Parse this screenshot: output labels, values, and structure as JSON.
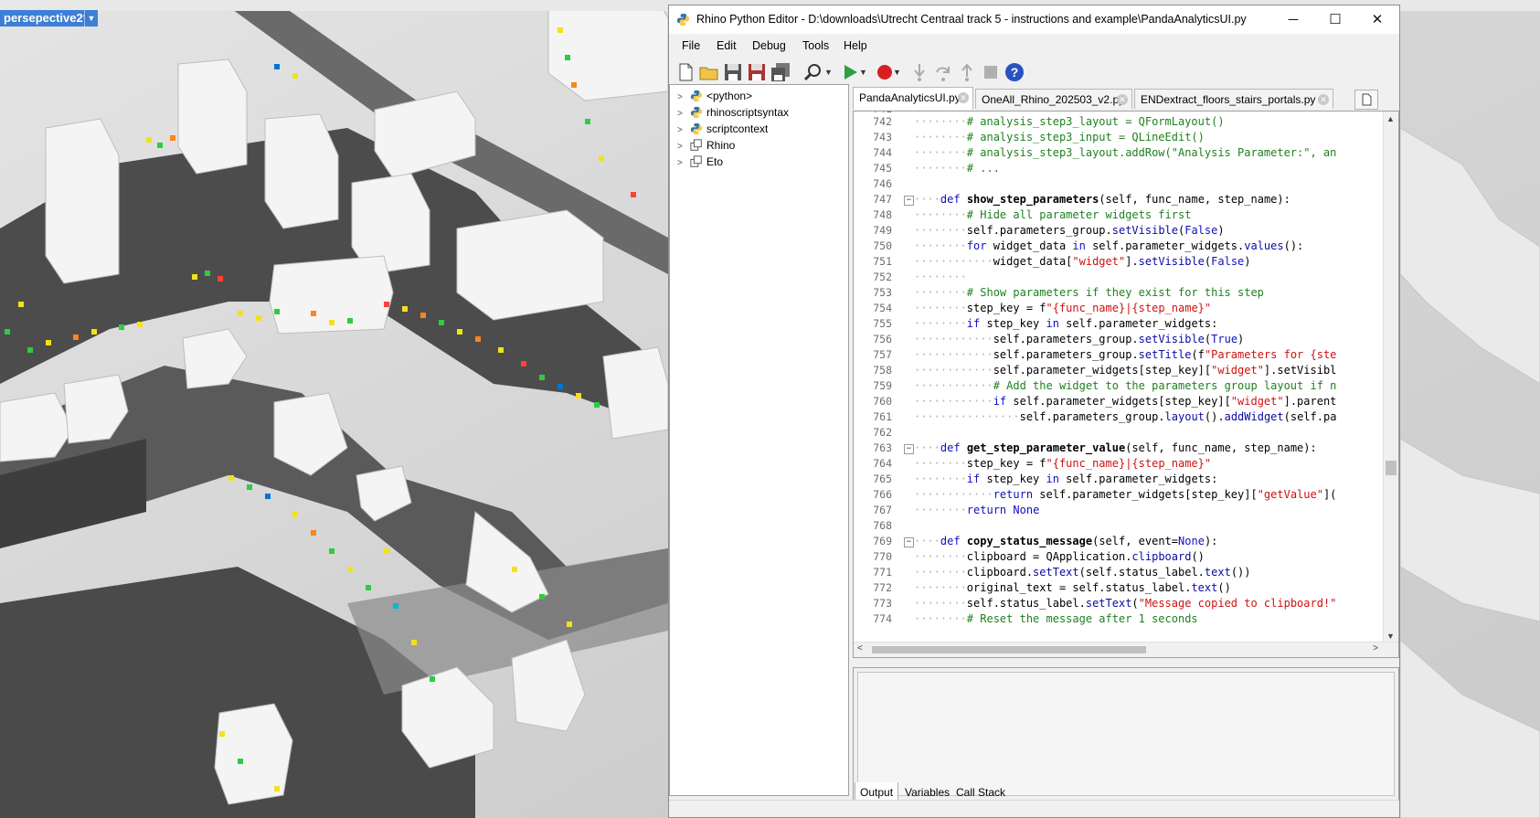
{
  "viewport": {
    "label": "persepective2*",
    "dropdown_icon": "chevron-down-icon"
  },
  "editor": {
    "title": "Rhino Python Editor - D:\\downloads\\Utrecht Centraal track 5 - instructions and example\\PandaAnalyticsUI.py",
    "window_buttons": {
      "minimize": "─",
      "maximize": "☐",
      "close": "✕"
    },
    "menu": [
      "File",
      "Edit",
      "Debug",
      "Tools",
      "Help"
    ],
    "toolbar_icons": [
      "new-file-icon",
      "open-folder-icon",
      "save-icon",
      "save-as-icon",
      "save-all-icon",
      "search-icon",
      "run-icon",
      "breakpoint-icon",
      "step-into-icon",
      "step-over-icon",
      "step-out-icon",
      "stop-icon",
      "help-icon"
    ],
    "tree": [
      {
        "label": "<python>",
        "icon": "python-icon"
      },
      {
        "label": "rhinoscriptsyntax",
        "icon": "python-icon"
      },
      {
        "label": "scriptcontext",
        "icon": "python-icon"
      },
      {
        "label": "Rhino",
        "icon": "namespace-icon"
      },
      {
        "label": "Eto",
        "icon": "namespace-icon"
      }
    ],
    "tabs": [
      {
        "label": "PandaAnalyticsUI.py",
        "active": true
      },
      {
        "label": "OneAll_Rhino_202503_v2.py",
        "active": false
      },
      {
        "label": "ENDextract_floors_stairs_portals.py",
        "active": false
      }
    ],
    "code_lines": [
      {
        "n": "742",
        "code": "        # analysis_step3_layout = QFormLayout()"
      },
      {
        "n": "743",
        "code": "        # analysis_step3_input = QLineEdit()"
      },
      {
        "n": "744",
        "code": "        # analysis_step3_layout.addRow(\"Analysis Parameter:\", an"
      },
      {
        "n": "745",
        "code": "        # ..."
      },
      {
        "n": "746",
        "code": ""
      },
      {
        "n": "747",
        "code": "    def show_step_parameters(self, func_name, step_name):"
      },
      {
        "n": "748",
        "code": "        # Hide all parameter widgets first"
      },
      {
        "n": "749",
        "code": "        self.parameters_group.setVisible(False)"
      },
      {
        "n": "750",
        "code": "        for widget_data in self.parameter_widgets.values():"
      },
      {
        "n": "751",
        "code": "            widget_data[\"widget\"].setVisible(False)"
      },
      {
        "n": "752",
        "code": "        "
      },
      {
        "n": "753",
        "code": "        # Show parameters if they exist for this step"
      },
      {
        "n": "754",
        "code": "        step_key = f\"{func_name}|{step_name}\""
      },
      {
        "n": "755",
        "code": "        if step_key in self.parameter_widgets:"
      },
      {
        "n": "756",
        "code": "            self.parameters_group.setVisible(True)"
      },
      {
        "n": "757",
        "code": "            self.parameters_group.setTitle(f\"Parameters for {ste"
      },
      {
        "n": "758",
        "code": "            self.parameter_widgets[step_key][\"widget\"].setVisibl"
      },
      {
        "n": "759",
        "code": "            # Add the widget to the parameters group layout if n"
      },
      {
        "n": "760",
        "code": "            if self.parameter_widgets[step_key][\"widget\"].parent"
      },
      {
        "n": "761",
        "code": "                self.parameters_group.layout().addWidget(self.pa"
      },
      {
        "n": "762",
        "code": ""
      },
      {
        "n": "763",
        "code": "    def get_step_parameter_value(self, func_name, step_name):"
      },
      {
        "n": "764",
        "code": "        step_key = f\"{func_name}|{step_name}\""
      },
      {
        "n": "765",
        "code": "        if step_key in self.parameter_widgets:"
      },
      {
        "n": "766",
        "code": "            return self.parameter_widgets[step_key][\"getValue\"]("
      },
      {
        "n": "767",
        "code": "        return None"
      },
      {
        "n": "768",
        "code": ""
      },
      {
        "n": "769",
        "code": "    def copy_status_message(self, event=None):"
      },
      {
        "n": "770",
        "code": "        clipboard = QApplication.clipboard()"
      },
      {
        "n": "771",
        "code": "        clipboard.setText(self.status_label.text())"
      },
      {
        "n": "772",
        "code": "        original_text = self.status_label.text()"
      },
      {
        "n": "773",
        "code": "        self.status_label.setText(\"Message copied to clipboard!\""
      },
      {
        "n": "774",
        "code": "        # Reset the message after 1 seconds"
      }
    ],
    "bottom_tabs": [
      "Output",
      "Variables",
      "Call Stack"
    ]
  }
}
